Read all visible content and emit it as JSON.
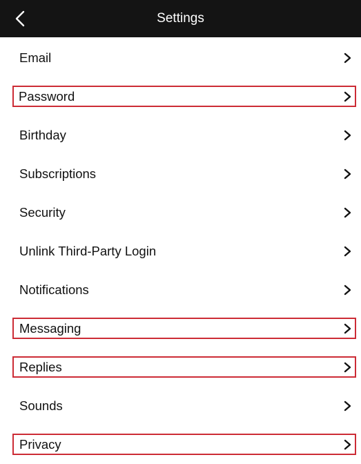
{
  "header": {
    "title": "Settings",
    "back_icon": "chevron-left-icon"
  },
  "settings": {
    "items": [
      {
        "label": "Email",
        "highlighted": false
      },
      {
        "label": "Password",
        "highlighted": true
      },
      {
        "label": "Birthday",
        "highlighted": false
      },
      {
        "label": "Subscriptions",
        "highlighted": false
      },
      {
        "label": "Security",
        "highlighted": false
      },
      {
        "label": "Unlink Third-Party Login",
        "highlighted": false
      },
      {
        "label": "Notifications",
        "highlighted": false
      },
      {
        "label": "Messaging",
        "highlighted": true
      },
      {
        "label": "Replies",
        "highlighted": true
      },
      {
        "label": "Sounds",
        "highlighted": false
      },
      {
        "label": "Privacy",
        "highlighted": true
      }
    ],
    "chevron_icon": "chevron-right-icon"
  },
  "colors": {
    "header_bg": "#141414",
    "highlight_border": "#cc2b35"
  }
}
